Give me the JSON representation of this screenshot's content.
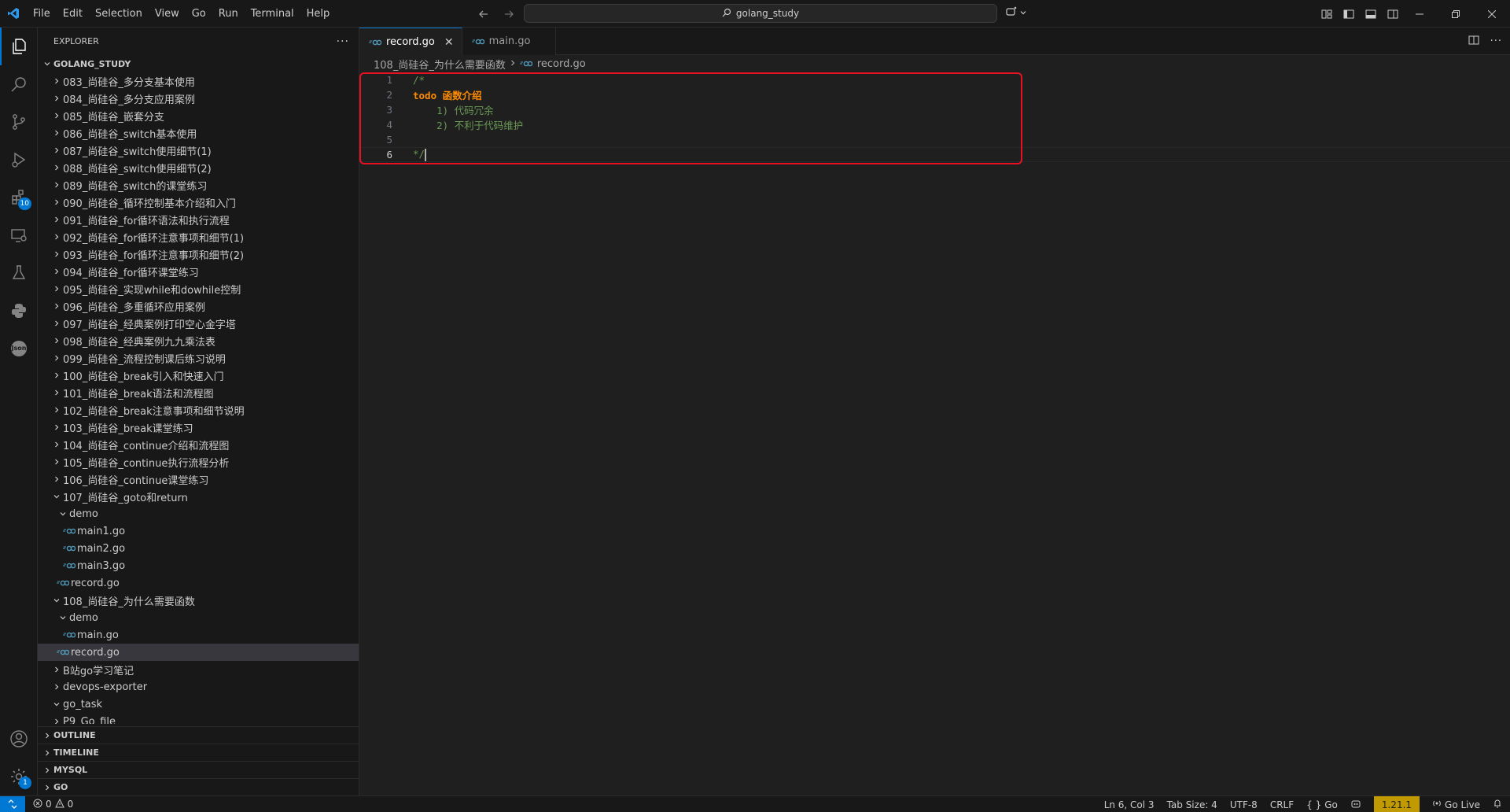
{
  "menu": [
    "File",
    "Edit",
    "Selection",
    "View",
    "Go",
    "Run",
    "Terminal",
    "Help"
  ],
  "search": {
    "label": "golang_study"
  },
  "sidebar": {
    "title": "EXPLORER",
    "root": "GOLANG_STUDY",
    "tree": [
      {
        "label": "083_尚硅谷_多分支基本使用",
        "level": 0,
        "kind": "folder",
        "open": false
      },
      {
        "label": "084_尚硅谷_多分支应用案例",
        "level": 0,
        "kind": "folder",
        "open": false
      },
      {
        "label": "085_尚硅谷_嵌套分支",
        "level": 0,
        "kind": "folder",
        "open": false
      },
      {
        "label": "086_尚硅谷_switch基本使用",
        "level": 0,
        "kind": "folder",
        "open": false
      },
      {
        "label": "087_尚硅谷_switch使用细节(1)",
        "level": 0,
        "kind": "folder",
        "open": false
      },
      {
        "label": "088_尚硅谷_switch使用细节(2)",
        "level": 0,
        "kind": "folder",
        "open": false
      },
      {
        "label": "089_尚硅谷_switch的课堂练习",
        "level": 0,
        "kind": "folder",
        "open": false
      },
      {
        "label": "090_尚硅谷_循环控制基本介绍和入门",
        "level": 0,
        "kind": "folder",
        "open": false
      },
      {
        "label": "091_尚硅谷_for循环语法和执行流程",
        "level": 0,
        "kind": "folder",
        "open": false
      },
      {
        "label": "092_尚硅谷_for循环注意事项和细节(1)",
        "level": 0,
        "kind": "folder",
        "open": false
      },
      {
        "label": "093_尚硅谷_for循环注意事项和细节(2)",
        "level": 0,
        "kind": "folder",
        "open": false
      },
      {
        "label": "094_尚硅谷_for循环课堂练习",
        "level": 0,
        "kind": "folder",
        "open": false
      },
      {
        "label": "095_尚硅谷_实现while和dowhile控制",
        "level": 0,
        "kind": "folder",
        "open": false
      },
      {
        "label": "096_尚硅谷_多重循环应用案例",
        "level": 0,
        "kind": "folder",
        "open": false
      },
      {
        "label": "097_尚硅谷_经典案例打印空心金字塔",
        "level": 0,
        "kind": "folder",
        "open": false
      },
      {
        "label": "098_尚硅谷_经典案例九九乘法表",
        "level": 0,
        "kind": "folder",
        "open": false
      },
      {
        "label": "099_尚硅谷_流程控制课后练习说明",
        "level": 0,
        "kind": "folder",
        "open": false
      },
      {
        "label": "100_尚硅谷_break引入和快速入门",
        "level": 0,
        "kind": "folder",
        "open": false
      },
      {
        "label": "101_尚硅谷_break语法和流程图",
        "level": 0,
        "kind": "folder",
        "open": false
      },
      {
        "label": "102_尚硅谷_break注意事项和细节说明",
        "level": 0,
        "kind": "folder",
        "open": false
      },
      {
        "label": "103_尚硅谷_break课堂练习",
        "level": 0,
        "kind": "folder",
        "open": false
      },
      {
        "label": "104_尚硅谷_continue介绍和流程图",
        "level": 0,
        "kind": "folder",
        "open": false
      },
      {
        "label": "105_尚硅谷_continue执行流程分析",
        "level": 0,
        "kind": "folder",
        "open": false
      },
      {
        "label": "106_尚硅谷_continue课堂练习",
        "level": 0,
        "kind": "folder",
        "open": false
      },
      {
        "label": "107_尚硅谷_goto和return",
        "level": 0,
        "kind": "folder",
        "open": true
      },
      {
        "label": "demo",
        "level": 1,
        "kind": "folder",
        "open": true
      },
      {
        "label": "main1.go",
        "level": 2,
        "kind": "file"
      },
      {
        "label": "main2.go",
        "level": 2,
        "kind": "file"
      },
      {
        "label": "main3.go",
        "level": 2,
        "kind": "file"
      },
      {
        "label": "record.go",
        "level": 1,
        "kind": "file"
      },
      {
        "label": "108_尚硅谷_为什么需要函数",
        "level": 0,
        "kind": "folder",
        "open": true
      },
      {
        "label": "demo",
        "level": 1,
        "kind": "folder",
        "open": true
      },
      {
        "label": "main.go",
        "level": 2,
        "kind": "file"
      },
      {
        "label": "record.go",
        "level": 1,
        "kind": "file",
        "selected": true
      },
      {
        "label": "B站go学习笔记",
        "level": 0,
        "kind": "folder",
        "open": false
      },
      {
        "label": "devops-exporter",
        "level": 0,
        "kind": "folder",
        "open": false
      },
      {
        "label": "go_task",
        "level": 0,
        "kind": "folder",
        "open": true
      },
      {
        "label": "P9_Go_file",
        "level": 0,
        "kind": "folder",
        "open": false
      }
    ],
    "sections": [
      "OUTLINE",
      "TIMELINE",
      "MYSQL",
      "GO"
    ]
  },
  "activity": {
    "extensions_badge": "10",
    "settings_badge": "1",
    "json_label": "Json"
  },
  "tabs": [
    {
      "label": "record.go",
      "active": true
    },
    {
      "label": "main.go",
      "active": false
    }
  ],
  "breadcrumb": {
    "folder": "108_尚硅谷_为什么需要函数",
    "file": "record.go"
  },
  "code": [
    {
      "n": "1",
      "text": "/*"
    },
    {
      "n": "2",
      "todo": "todo",
      "rest": " 函数介绍"
    },
    {
      "n": "3",
      "text": "    1) 代码冗余"
    },
    {
      "n": "4",
      "text": "    2) 不利于代码维护"
    },
    {
      "n": "5",
      "text": ""
    },
    {
      "n": "6",
      "text": "*/"
    }
  ],
  "status": {
    "errors": "0",
    "warnings": "0",
    "position": "Ln 6, Col 3",
    "tab_size": "Tab Size: 4",
    "encoding": "UTF-8",
    "eol": "CRLF",
    "language": "Go",
    "go_version": "1.21.1",
    "go_live": "Go Live"
  },
  "colors": {
    "accent": "#0078d4",
    "highlight": "#e81123",
    "comment": "#6a9955",
    "todo": "#ff8c00",
    "go_badge": "#c09a00"
  }
}
